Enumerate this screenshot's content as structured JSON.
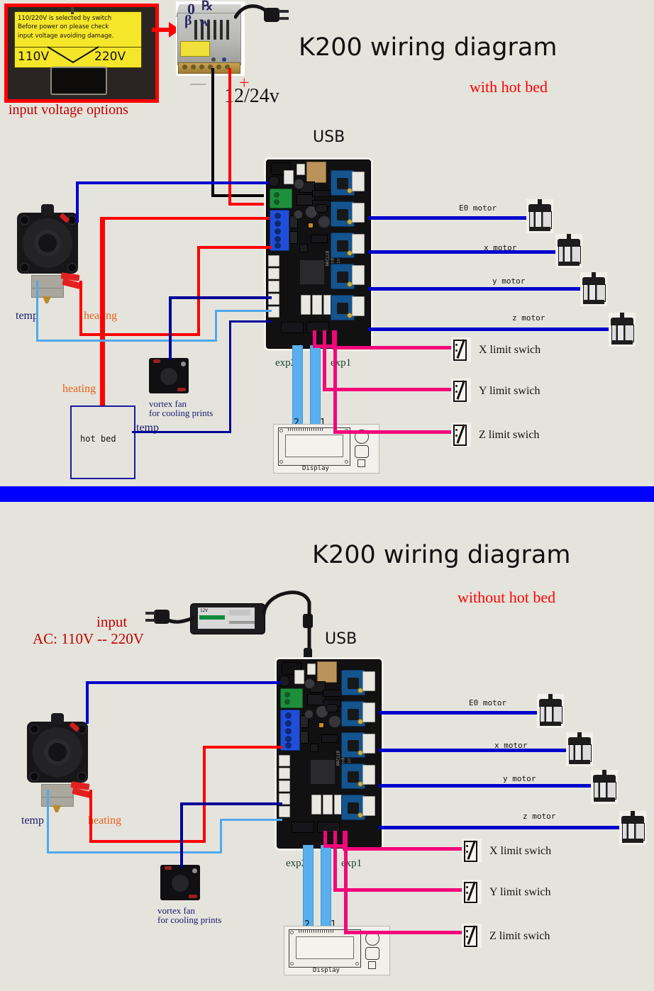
{
  "meta": {
    "bg_color": "#e5e4dc",
    "divider_color": "#0000ff",
    "accent_red": "#ff0000",
    "wire_blue": "#0000cc",
    "wire_lightblue": "#4fa8ef",
    "wire_pink": "#f2067a",
    "wire_black": "#000000"
  },
  "top_panel": {
    "title": "K200 wiring diagram",
    "subtitle": "with hot bed",
    "voltage_callout": {
      "caption": "input voltage options",
      "note_line1": "110/220V is selected by  switch",
      "note_line2": "Before power on please check",
      "note_line3": "input voltage avoiding damage.",
      "left_value": "110V",
      "right_value": "220V"
    },
    "psu": {
      "output_label": "12/24v",
      "plus_sign": "+",
      "minus_sign": "—"
    },
    "board": {
      "usb_label": "USB",
      "exp1_label": "exp1",
      "exp2_label": "exp2",
      "silk_line1": "BTT200",
      "silk_line2": "Ramps",
      "silk_line3": "Printer",
      "silk_version": "V1.2_00"
    },
    "display": {
      "label": "Display",
      "port2_label": "2",
      "port1_label": "1"
    },
    "hotend": {
      "temp_label": "temp",
      "heating_label": "heating"
    },
    "vortex_fan": {
      "line1": "vortex fan",
      "line2": "for cooling prints"
    },
    "hot_bed": {
      "box_label": "hot bed",
      "heating_label": "heating",
      "temp_label": "temp"
    },
    "motors": [
      {
        "label": "E0 motor"
      },
      {
        "label": "x motor"
      },
      {
        "label": "y motor"
      },
      {
        "label": "z motor"
      }
    ],
    "limit_switches": [
      {
        "label": "X limit swich"
      },
      {
        "label": "Y limit swich"
      },
      {
        "label": "Z limit swich"
      }
    ]
  },
  "bottom_panel": {
    "title": "K200 wiring diagram",
    "subtitle": "without hot bed",
    "power": {
      "input_label": "input",
      "ac_label": "AC: 110V -- 220V",
      "adapter_voltage": "12V"
    },
    "board": {
      "usb_label": "USB",
      "exp1_label": "exp1",
      "exp2_label": "exp2",
      "silk_line1": "BTT200",
      "silk_line2": "Ramps",
      "silk_line3": "Printer",
      "silk_version": "V1.2_00"
    },
    "display": {
      "label": "Display",
      "port2_label": "2",
      "port1_label": "1"
    },
    "hotend": {
      "temp_label": "temp",
      "heating_label": "heating"
    },
    "vortex_fan": {
      "line1": "vortex fan",
      "line2": "for cooling prints"
    },
    "motors": [
      {
        "label": "E0 motor"
      },
      {
        "label": "x motor"
      },
      {
        "label": "y motor"
      },
      {
        "label": "z motor"
      }
    ],
    "limit_switches": [
      {
        "label": "X limit swich"
      },
      {
        "label": "Y limit swich"
      },
      {
        "label": "Z limit swich"
      }
    ]
  }
}
